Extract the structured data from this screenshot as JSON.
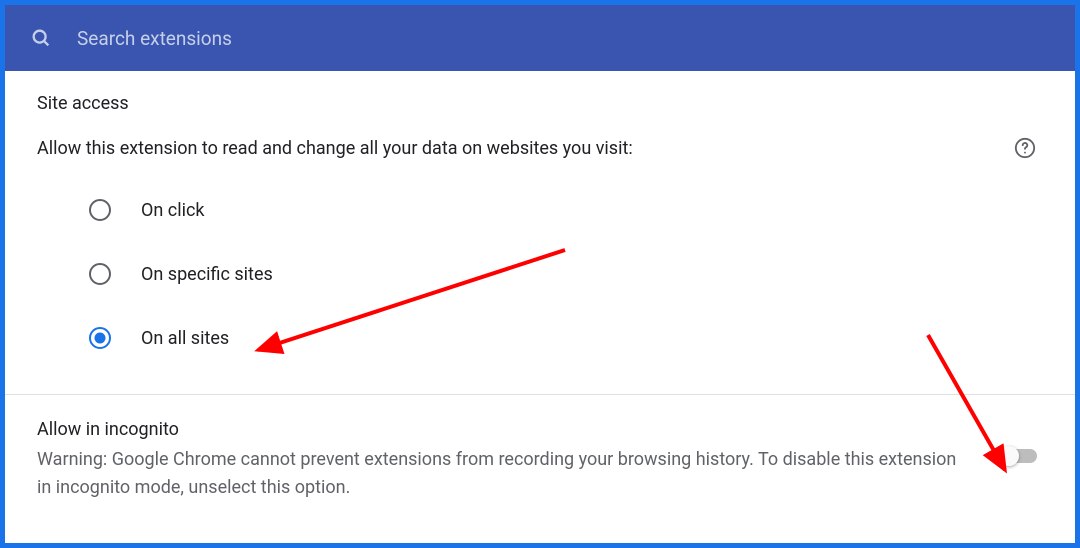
{
  "search": {
    "placeholder": "Search extensions"
  },
  "siteAccess": {
    "title": "Site access",
    "description": "Allow this extension to read and change all your data on websites you visit:",
    "options": [
      {
        "label": "On click",
        "selected": false
      },
      {
        "label": "On specific sites",
        "selected": false
      },
      {
        "label": "On all sites",
        "selected": true
      }
    ]
  },
  "incognito": {
    "title": "Allow in incognito",
    "warning": "Warning: Google Chrome cannot prevent extensions from recording your browsing history. To disable this extension in incognito mode, unselect this option.",
    "enabled": false
  }
}
